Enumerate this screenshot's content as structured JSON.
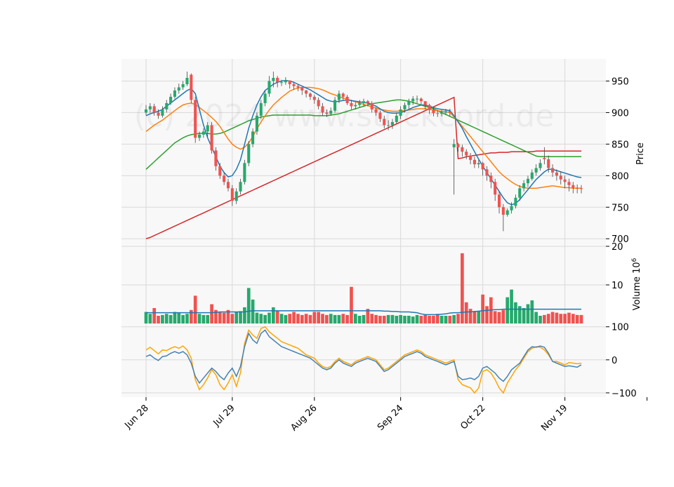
{
  "watermark": "(c) 2024 www.stockcord.de",
  "colors": {
    "panel_bg": "#f8f8f8",
    "grid": "#d9d9d9",
    "up": "#26a96c",
    "down": "#ef5350",
    "ma_fast": "#1f77b4",
    "ma_mid": "#ff7f0e",
    "ma_slow": "#2ca02c",
    "ma_long": "#d62728",
    "volume_ma": "#1f77b4",
    "osc_1": "#4682b4",
    "osc_2": "#ffa500"
  },
  "chart_data": {
    "type": "candlestick",
    "x_tick_labels": [
      "Jun 28",
      "Jul 29",
      "Aug 26",
      "Sep 24",
      "Oct 22",
      "Nov 19"
    ],
    "x_tick_index": [
      0,
      21,
      41,
      62,
      82,
      102
    ],
    "n_sessions": 123,
    "price": {
      "ylabel": "Price",
      "ylim": [
        688,
        985
      ],
      "ticks": [
        700,
        750,
        800,
        850,
        900,
        950
      ],
      "close": [
        905,
        910,
        900,
        895,
        905,
        915,
        925,
        935,
        940,
        945,
        955,
        920,
        860,
        865,
        870,
        880,
        840,
        815,
        800,
        790,
        780,
        760,
        775,
        790,
        820,
        850,
        870,
        895,
        915,
        930,
        950,
        955,
        948,
        948,
        951,
        945,
        942,
        940,
        935,
        930,
        925,
        920,
        910,
        900,
        898,
        903,
        920,
        930,
        925,
        915,
        910,
        912,
        915,
        918,
        915,
        905,
        900,
        890,
        880,
        880,
        885,
        895,
        905,
        912,
        918,
        922,
        922,
        918,
        912,
        904,
        899,
        898,
        900,
        902,
        900,
        850,
        845,
        838,
        832,
        825,
        818,
        820,
        810,
        800,
        790,
        770,
        750,
        738,
        745,
        752,
        765,
        780,
        788,
        795,
        805,
        812,
        820,
        826,
        812,
        805,
        800,
        794,
        790,
        785,
        781,
        780,
        779
      ],
      "open": [
        900,
        905,
        910,
        900,
        895,
        905,
        915,
        925,
        935,
        940,
        945,
        960,
        920,
        860,
        865,
        870,
        880,
        840,
        815,
        800,
        790,
        780,
        760,
        775,
        790,
        820,
        850,
        870,
        895,
        915,
        930,
        950,
        955,
        948,
        948,
        951,
        945,
        942,
        940,
        935,
        930,
        925,
        920,
        910,
        900,
        898,
        903,
        920,
        930,
        925,
        915,
        910,
        912,
        915,
        918,
        915,
        905,
        900,
        890,
        880,
        880,
        885,
        895,
        905,
        912,
        918,
        922,
        922,
        918,
        912,
        904,
        899,
        898,
        900,
        902,
        845,
        850,
        845,
        838,
        832,
        825,
        818,
        820,
        810,
        800,
        790,
        770,
        750,
        738,
        745,
        752,
        765,
        780,
        788,
        795,
        805,
        812,
        828,
        826,
        812,
        805,
        800,
        794,
        790,
        785,
        781,
        780
      ],
      "high": [
        912,
        915,
        914,
        905,
        910,
        920,
        930,
        940,
        946,
        950,
        965,
        962,
        925,
        870,
        875,
        885,
        885,
        845,
        820,
        805,
        795,
        785,
        780,
        795,
        825,
        855,
        875,
        900,
        920,
        935,
        958,
        965,
        958,
        952,
        956,
        950,
        948,
        945,
        940,
        936,
        932,
        928,
        924,
        915,
        905,
        908,
        925,
        935,
        932,
        928,
        920,
        916,
        920,
        922,
        920,
        918,
        908,
        903,
        895,
        888,
        890,
        900,
        910,
        916,
        922,
        926,
        927,
        924,
        918,
        914,
        908,
        904,
        904,
        906,
        906,
        858,
        852,
        849,
        842,
        836,
        830,
        825,
        822,
        815,
        805,
        795,
        775,
        755,
        748,
        758,
        770,
        785,
        793,
        800,
        810,
        818,
        826,
        845,
        832,
        818,
        810,
        806,
        800,
        795,
        790,
        786,
        785
      ],
      "low": [
        896,
        900,
        895,
        890,
        892,
        900,
        912,
        922,
        930,
        936,
        942,
        915,
        852,
        855,
        860,
        862,
        835,
        808,
        795,
        785,
        775,
        752,
        755,
        770,
        786,
        815,
        845,
        865,
        890,
        910,
        925,
        940,
        940,
        942,
        944,
        938,
        936,
        934,
        928,
        924,
        920,
        914,
        905,
        895,
        893,
        895,
        900,
        915,
        920,
        912,
        905,
        905,
        908,
        910,
        910,
        900,
        895,
        885,
        875,
        872,
        874,
        882,
        890,
        900,
        906,
        912,
        915,
        912,
        905,
        898,
        894,
        893,
        894,
        896,
        894,
        770,
        838,
        830,
        826,
        818,
        812,
        812,
        800,
        792,
        780,
        760,
        740,
        712,
        735,
        740,
        748,
        760,
        775,
        782,
        792,
        800,
        808,
        818,
        805,
        798,
        792,
        786,
        780,
        775,
        772,
        772,
        772
      ],
      "ma_fast": [
        895,
        898,
        900,
        902,
        905,
        910,
        915,
        920,
        925,
        930,
        935,
        938,
        930,
        905,
        880,
        860,
        845,
        830,
        815,
        805,
        798,
        800,
        810,
        825,
        850,
        875,
        895,
        912,
        925,
        935,
        940,
        945,
        948,
        950,
        951,
        950,
        948,
        945,
        942,
        939,
        936,
        932,
        928,
        924,
        920,
        918,
        917,
        918,
        919,
        920,
        919,
        918,
        917,
        916,
        915,
        913,
        910,
        906,
        902,
        900,
        899,
        899,
        900,
        902,
        905,
        908,
        910,
        912,
        912,
        910,
        908,
        906,
        905,
        904,
        903,
        895,
        885,
        875,
        862,
        850,
        838,
        826,
        815,
        805,
        795,
        785,
        775,
        765,
        757,
        754,
        756,
        762,
        770,
        778,
        786,
        794,
        800,
        806,
        810,
        810,
        808,
        806,
        804,
        802,
        800,
        798,
        797
      ],
      "ma_mid": [
        870,
        875,
        880,
        884,
        888,
        893,
        898,
        903,
        908,
        912,
        914,
        915,
        913,
        908,
        903,
        898,
        892,
        886,
        878,
        868,
        858,
        850,
        845,
        842,
        845,
        852,
        862,
        874,
        885,
        895,
        904,
        912,
        918,
        924,
        929,
        934,
        937,
        939,
        940,
        940,
        940,
        939,
        938,
        936,
        933,
        930,
        928,
        925,
        923,
        921,
        919,
        917,
        915,
        913,
        911,
        909,
        907,
        905,
        904,
        903,
        902,
        902,
        903,
        903,
        904,
        905,
        906,
        906,
        906,
        905,
        904,
        903,
        902,
        901,
        900,
        893,
        886,
        878,
        870,
        862,
        854,
        846,
        838,
        830,
        822,
        814,
        806,
        800,
        795,
        790,
        786,
        783,
        781,
        780,
        780,
        780,
        781,
        782,
        783,
        784,
        783,
        782,
        781,
        781,
        780,
        780,
        780
      ],
      "ma_slow": [
        810,
        816,
        822,
        828,
        834,
        840,
        846,
        852,
        856,
        860,
        863,
        865,
        866,
        867,
        867,
        867,
        866,
        866,
        867,
        869,
        872,
        875,
        878,
        881,
        884,
        887,
        889,
        891,
        893,
        894,
        895,
        896,
        896,
        896,
        896,
        896,
        896,
        896,
        896,
        896,
        896,
        895,
        895,
        895,
        895,
        896,
        897,
        898,
        900,
        902,
        904,
        906,
        908,
        910,
        912,
        914,
        915,
        916,
        917,
        918,
        919,
        920,
        920,
        919,
        918,
        916,
        914,
        912,
        910,
        908,
        906,
        903,
        900,
        897,
        894,
        891,
        888,
        885,
        882,
        879,
        876,
        873,
        870,
        867,
        864,
        861,
        858,
        855,
        852,
        849,
        846,
        843,
        840,
        837,
        834,
        831,
        830,
        830,
        830,
        830,
        830,
        830,
        830,
        830,
        830,
        830,
        830
      ],
      "ma_long": [
        700,
        702,
        705,
        708,
        711,
        714,
        717,
        720,
        723,
        726,
        729,
        732,
        735,
        738,
        741,
        744,
        747,
        750,
        753,
        756,
        759,
        762,
        765,
        768,
        771,
        774,
        777,
        780,
        783,
        786,
        789,
        792,
        795,
        798,
        801,
        804,
        807,
        810,
        813,
        816,
        819,
        822,
        825,
        828,
        831,
        834,
        837,
        840,
        843,
        846,
        849,
        852,
        855,
        858,
        861,
        864,
        867,
        870,
        873,
        876,
        879,
        882,
        885,
        888,
        891,
        894,
        897,
        900,
        903,
        906,
        909,
        912,
        915,
        918,
        921,
        924,
        827,
        828,
        830,
        831,
        832,
        833,
        834,
        835,
        836,
        836,
        837,
        837,
        837,
        838,
        838,
        838,
        838,
        838,
        838,
        839,
        839,
        839,
        839,
        839,
        839,
        839,
        839,
        839,
        839,
        839,
        839
      ]
    },
    "volume": {
      "ylabel": "Volume  10^6",
      "ylim": [
        0,
        20
      ],
      "ticks": [
        10,
        20
      ],
      "values": [
        3,
        2.5,
        4,
        2,
        2.2,
        2.5,
        2.2,
        3,
        2.8,
        2.2,
        2.5,
        3.5,
        7.2,
        2.5,
        2.2,
        2.2,
        5,
        3.5,
        3,
        2.8,
        3.5,
        2.5,
        3,
        3.2,
        4.2,
        9.2,
        6.2,
        2.8,
        2.5,
        2.2,
        2.8,
        4.2,
        3.2,
        2.5,
        2.2,
        2.5,
        3,
        2.5,
        2.2,
        2.5,
        2.2,
        3,
        3,
        2.5,
        2.2,
        2.5,
        2.2,
        2.2,
        2.5,
        2.2,
        9.5,
        2.5,
        2,
        2.2,
        3.8,
        2.5,
        2.2,
        2,
        2,
        2.2,
        2.2,
        2,
        2.2,
        2,
        2,
        1.8,
        2.2,
        2,
        2.2,
        2,
        2,
        2.5,
        2,
        2,
        2,
        2.2,
        2.5,
        18.2,
        5.5,
        3.8,
        3.2,
        3.2,
        7.5,
        4.5,
        6.8,
        3.2,
        3,
        3.5,
        6.8,
        8.8,
        5.5,
        4.5,
        4,
        5,
        6,
        3,
        2,
        2.2,
        2.5,
        3,
        2.8,
        2.5,
        2.5,
        2.8,
        2.5,
        2.2,
        2.2
      ],
      "ma": [
        2.8,
        2.8,
        2.8,
        2.8,
        2.8,
        2.8,
        2.8,
        2.8,
        2.8,
        2.8,
        2.8,
        2.8,
        2.8,
        2.8,
        2.8,
        2.8,
        2.8,
        2.9,
        3,
        3,
        3,
        3,
        3,
        3,
        3,
        3.2,
        3.3,
        3.3,
        3.3,
        3.3,
        3.3,
        3.3,
        3.3,
        3.3,
        3.3,
        3.3,
        3.3,
        3.3,
        3.3,
        3.3,
        3.3,
        3.3,
        3.3,
        3.3,
        3.3,
        3.3,
        3.3,
        3.3,
        3.3,
        3.3,
        3.3,
        3.3,
        3.3,
        3.3,
        3.3,
        3.3,
        3.3,
        3.3,
        3.2,
        3.2,
        3.1,
        3.1,
        3,
        3,
        3,
        2.9,
        2.8,
        2.5,
        2.3,
        2.3,
        2.3,
        2.3,
        2.4,
        2.5,
        2.7,
        2.8,
        2.8,
        2.9,
        3,
        3,
        3.1,
        3.2,
        3.3,
        3.4,
        3.5,
        3.6,
        3.6,
        3.7,
        3.7,
        3.7,
        3.7,
        3.7,
        3.7,
        3.7,
        3.7,
        3.7,
        3.7,
        3.7,
        3.7,
        3.7,
        3.7,
        3.7,
        3.7,
        3.7,
        3.7,
        3.7,
        3.7
      ]
    },
    "oscillator": {
      "ylim": [
        -113,
        110
      ],
      "ticks": [
        -100,
        0,
        100
      ],
      "line_1": [
        10,
        15,
        5,
        -2,
        10,
        12,
        20,
        25,
        20,
        25,
        15,
        -10,
        -50,
        -70,
        -55,
        -40,
        -25,
        -35,
        -50,
        -60,
        -40,
        -25,
        -50,
        -20,
        40,
        80,
        60,
        50,
        80,
        90,
        70,
        60,
        50,
        40,
        35,
        30,
        25,
        20,
        15,
        10,
        5,
        -5,
        -15,
        -25,
        -30,
        -25,
        -10,
        0,
        -10,
        -15,
        -20,
        -10,
        -5,
        0,
        5,
        0,
        -5,
        -20,
        -35,
        -30,
        -20,
        -10,
        0,
        10,
        15,
        20,
        25,
        20,
        10,
        5,
        0,
        -5,
        -10,
        -15,
        -10,
        -5,
        -50,
        -60,
        -58,
        -55,
        -60,
        -50,
        -25,
        -20,
        -30,
        -40,
        -55,
        -65,
        -50,
        -30,
        -20,
        -10,
        10,
        30,
        40,
        38,
        42,
        38,
        20,
        -5,
        -10,
        -15,
        -20,
        -18,
        -20,
        -22,
        -15
      ],
      "line_2": [
        30,
        38,
        28,
        18,
        30,
        28,
        35,
        40,
        35,
        42,
        30,
        5,
        -60,
        -90,
        -75,
        -55,
        -30,
        -45,
        -75,
        -90,
        -70,
        -45,
        -80,
        -40,
        50,
        90,
        75,
        65,
        95,
        100,
        85,
        75,
        65,
        55,
        50,
        45,
        40,
        35,
        25,
        15,
        10,
        5,
        -10,
        -20,
        -25,
        -20,
        -5,
        5,
        -5,
        -10,
        -15,
        -5,
        0,
        5,
        10,
        5,
        0,
        -15,
        -30,
        -25,
        -15,
        -5,
        5,
        15,
        20,
        25,
        30,
        25,
        15,
        10,
        5,
        0,
        -5,
        -10,
        -5,
        0,
        -60,
        -75,
        -80,
        -85,
        -100,
        -85,
        -35,
        -30,
        -40,
        -60,
        -85,
        -100,
        -70,
        -50,
        -30,
        -15,
        5,
        25,
        35,
        40,
        38,
        30,
        15,
        -5,
        -5,
        -10,
        -15,
        -8,
        -10,
        -12,
        -10
      ]
    }
  }
}
